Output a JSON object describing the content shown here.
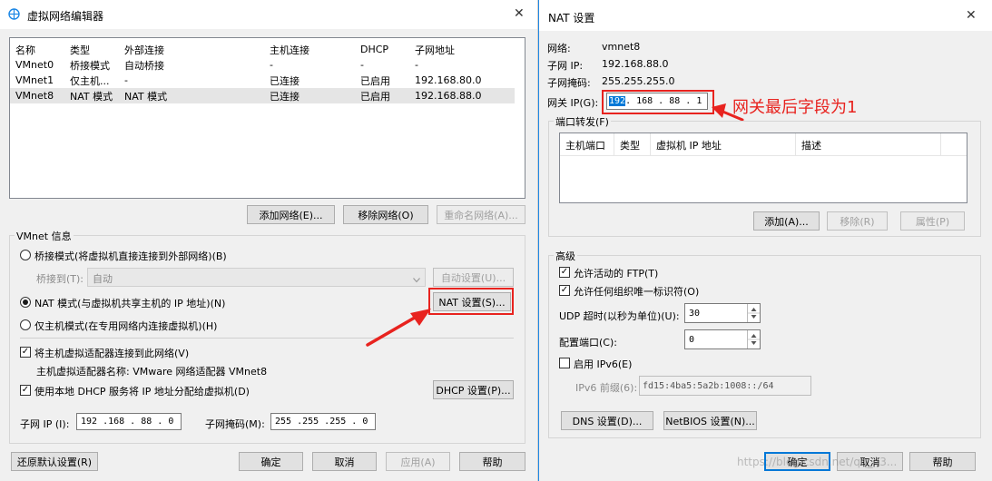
{
  "vne": {
    "title": "虚拟网络编辑器",
    "close": "✕",
    "columns": [
      "名称",
      "类型",
      "外部连接",
      "主机连接",
      "DHCP",
      "子网地址"
    ],
    "rows": [
      [
        "VMnet0",
        "桥接模式",
        "自动桥接",
        "-",
        "-",
        "-"
      ],
      [
        "VMnet1",
        "仅主机...",
        "-",
        "已连接",
        "已启用",
        "192.168.80.0"
      ],
      [
        "VMnet8",
        "NAT 模式",
        "NAT 模式",
        "已连接",
        "已启用",
        "192.168.88.0"
      ]
    ],
    "add_network": "添加网络(E)...",
    "remove_network": "移除网络(O)",
    "rename_network": "重命名网络(A)...",
    "info_title": "VMnet 信息",
    "bridge_mode": "桥接模式(将虚拟机直接连接到外部网络)(B)",
    "bridge_to_label": "桥接到(T):",
    "bridge_to_value": "自动",
    "auto_settings": "自动设置(U)...",
    "nat_mode": "NAT 模式(与虚拟机共享主机的 IP 地址)(N)",
    "nat_settings": "NAT 设置(S)...",
    "host_only": "仅主机模式(在专用网络内连接虚拟机)(H)",
    "connect_adapter": "将主机虚拟适配器连接到此网络(V)",
    "adapter_name": "主机虚拟适配器名称: VMware 网络适配器 VMnet8",
    "use_dhcp": "使用本地 DHCP 服务将 IP 地址分配给虚拟机(D)",
    "dhcp_settings": "DHCP 设置(P)...",
    "subnet_ip_label": "子网 IP (I):",
    "subnet_ip_value": "192 .168 . 88 .  0",
    "subnet_mask_label": "子网掩码(M):",
    "subnet_mask_value": "255 .255 .255 .  0",
    "restore_defaults": "还原默认设置(R)",
    "ok": "确定",
    "cancel": "取消",
    "apply": "应用(A)",
    "help": "帮助"
  },
  "nat": {
    "title": "NAT 设置",
    "close": "✕",
    "network_label": "网络:",
    "network_value": "vmnet8",
    "subnet_ip_label": "子网 IP:",
    "subnet_ip_value": "192.168.88.0",
    "subnet_mask_label": "子网掩码:",
    "subnet_mask_value": "255.255.255.0",
    "gateway_label": "网关 IP(G):",
    "gateway_sel": "192",
    "gateway_rest": " . 168 . 88  .  1",
    "annotation": "网关最后字段为1",
    "port_forward_title": "端口转发(F)",
    "pf_columns": [
      "主机端口",
      "类型",
      "虚拟机 IP 地址",
      "描述"
    ],
    "add": "添加(A)...",
    "remove": "移除(R)",
    "properties": "属性(P)",
    "advanced_title": "高级",
    "allow_ftp": "允许活动的 FTP(T)",
    "allow_uid": "允许任何组织唯一标识符(O)",
    "udp_timeout_label": "UDP 超时(以秒为单位)(U):",
    "udp_timeout_value": "30",
    "config_port_label": "配置端口(C):",
    "config_port_value": "0",
    "enable_ipv6": "启用 IPv6(E)",
    "ipv6_prefix_label": "IPv6 前缀(6):",
    "ipv6_prefix_value": "fd15:4ba5:5a2b:1008::/64",
    "dns_settings": "DNS 设置(D)...",
    "netbios_settings": "NetBIOS 设置(N)...",
    "ok": "确定",
    "cancel": "取消",
    "help": "帮助",
    "watermark": "https://blog.csdn.net/qq_43..."
  },
  "colors": {
    "highlight_red": "#e8231f",
    "title_blue": "#1e88e5",
    "selection_blue": "#0078d7"
  }
}
